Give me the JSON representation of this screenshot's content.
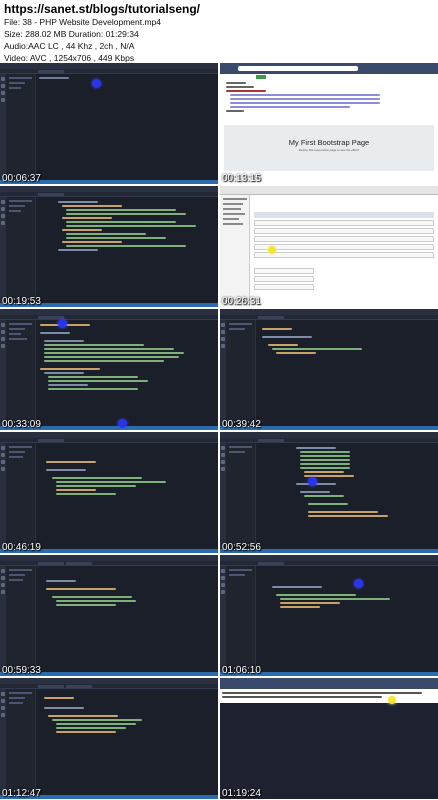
{
  "header": {
    "url": "https://sanet.st/blogs/tutorialseng/",
    "file": "File: 38 - PHP Website Development.mp4",
    "size": "Size: 288.02 MB Duration: 01:29:34",
    "audio": "Audio:AAC LC , 44 Khz , 2ch , N/A",
    "video": "Video: AVC , 1254x706 , 449 Kbps"
  },
  "thumbnails": [
    {
      "timestamp": "00:06:37",
      "kind": "editor"
    },
    {
      "timestamp": "00:13:15",
      "kind": "browser",
      "page_heading": "My First Bootstrap Page",
      "page_sub": "Resize this responsive page to see the effect!"
    },
    {
      "timestamp": "00:19:53",
      "kind": "editor"
    },
    {
      "timestamp": "00:26:31",
      "kind": "pma"
    },
    {
      "timestamp": "00:33:09",
      "kind": "editor"
    },
    {
      "timestamp": "00:39:42",
      "kind": "editor"
    },
    {
      "timestamp": "00:46:19",
      "kind": "editor"
    },
    {
      "timestamp": "00:52:56",
      "kind": "editor"
    },
    {
      "timestamp": "00:59:33",
      "kind": "editor"
    },
    {
      "timestamp": "01:06:10",
      "kind": "editor"
    },
    {
      "timestamp": "01:12:47",
      "kind": "editor"
    },
    {
      "timestamp": "01:19:24",
      "kind": "dark-browser"
    }
  ]
}
